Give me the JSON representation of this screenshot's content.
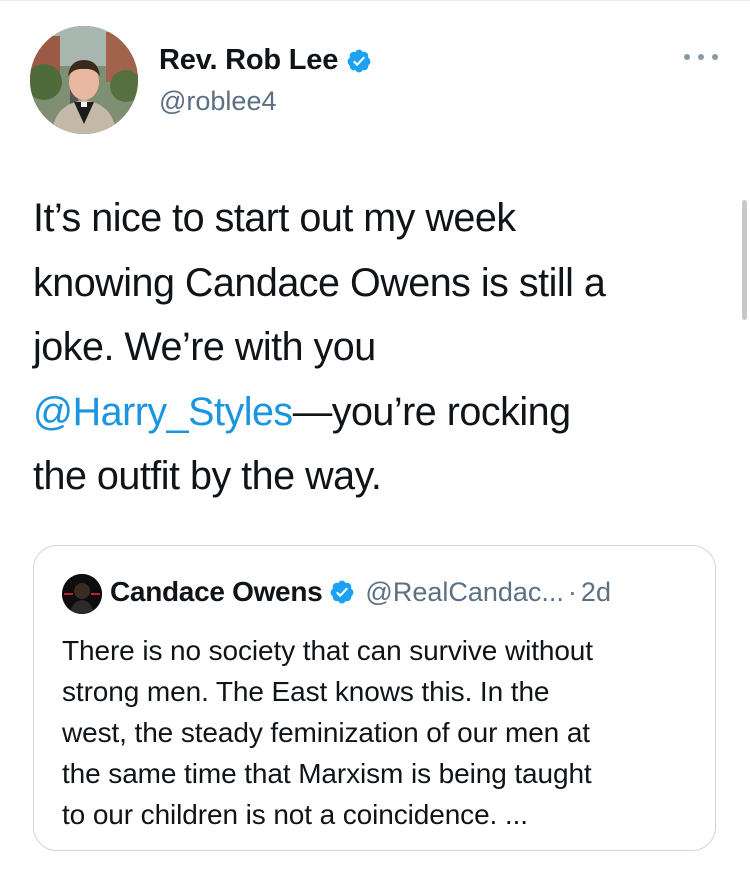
{
  "author": {
    "name": "Rev. Rob Lee",
    "handle": "@roblee4",
    "verified": true
  },
  "tweet": {
    "text_lines": [
      "It’s nice to start out my week",
      "knowing Candace Owens is still a",
      "joke. We’re with you"
    ],
    "mention": "@Harry_Styles",
    "after_mention": "—you’re rocking",
    "last_line": "the outfit by the way."
  },
  "quoted": {
    "name": "Candace Owens",
    "handle": "@RealCandac...",
    "separator": "·",
    "time": "2d",
    "verified": true,
    "text_lines": [
      "There is no society that can survive without",
      "strong men. The East knows this. In the",
      "west, the steady feminization of our men at",
      "the same time that Marxism is being taught",
      "to our children is not a coincidence. ..."
    ]
  },
  "colors": {
    "verified_badge": "#1da1f2",
    "mention": "#1b95e0",
    "secondary_text": "#5b7083",
    "border": "#ccd6dd"
  },
  "icons": {
    "verified": "verified-badge-icon",
    "more": "more-options-icon"
  }
}
